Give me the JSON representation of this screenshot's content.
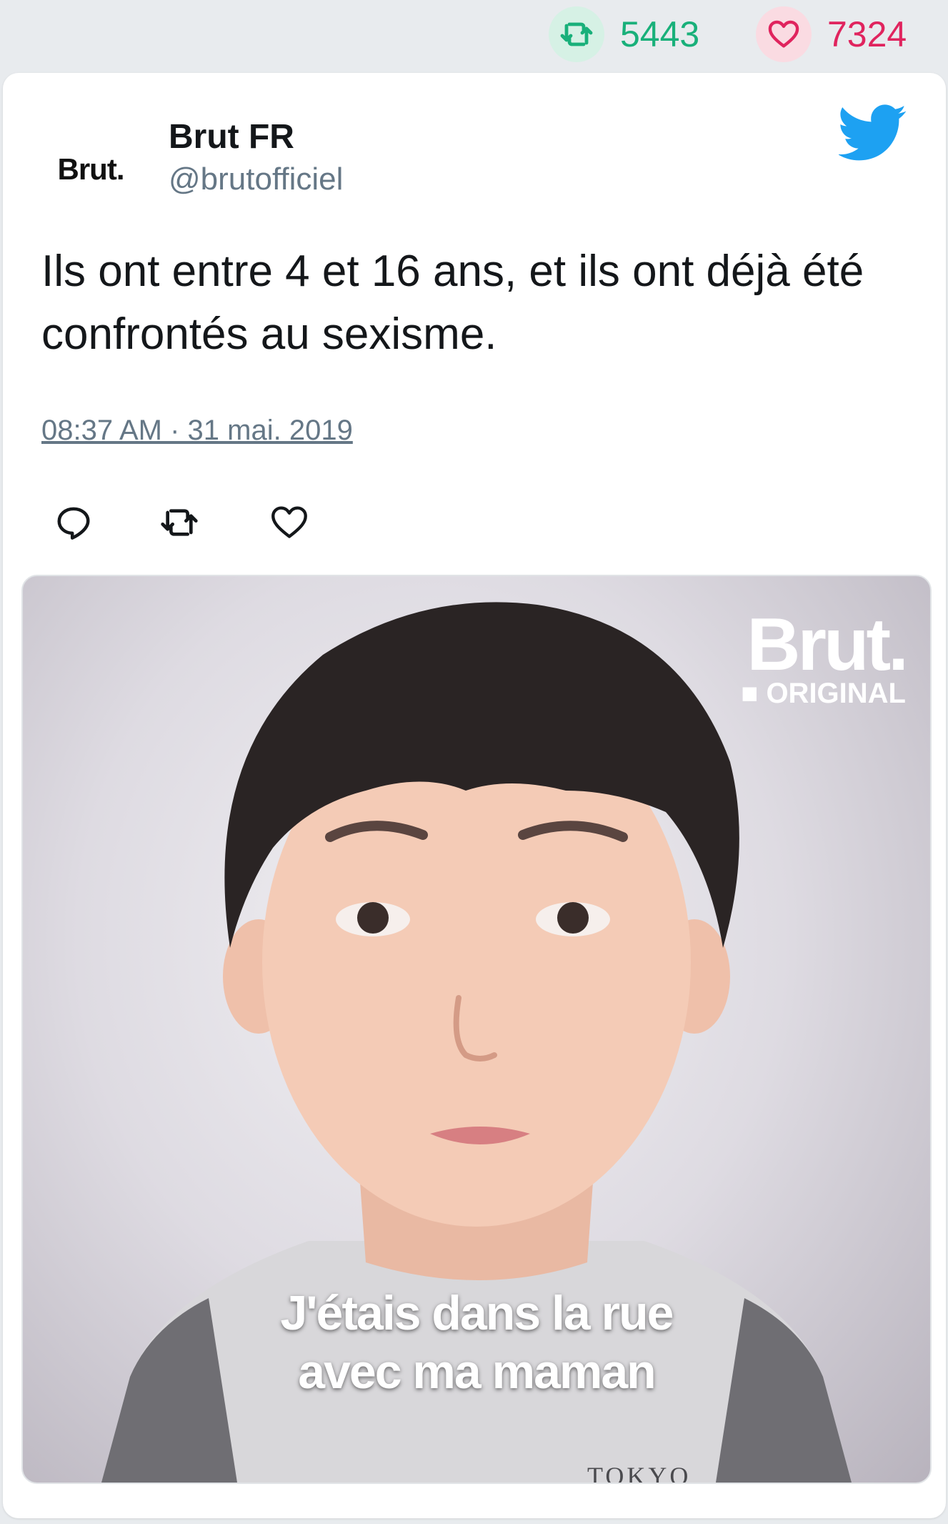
{
  "stats": {
    "retweets": "5443",
    "likes": "7324"
  },
  "tweet": {
    "avatar_text": "Brut.",
    "name": "Brut FR",
    "handle": "@brutofficiel",
    "text": "Ils ont entre 4 et 16 ans, et ils ont déjà été confrontés au sexisme.",
    "timestamp": "08:37 AM · 31 mai. 2019"
  },
  "media": {
    "watermark_brand": "Brut.",
    "watermark_sub": "■ ORIGINAL",
    "caption_line1": "J'étais dans la rue",
    "caption_line2": "avec ma maman",
    "shirt_text": "TOKYO"
  },
  "icons": {
    "retweet": "retweet-icon",
    "like": "heart-icon",
    "reply": "reply-icon",
    "brand": "twitter-bird-icon"
  },
  "colors": {
    "retweet": "#19b07a",
    "like": "#e0245e",
    "twitter_blue": "#1da1f2",
    "muted": "#657786"
  }
}
